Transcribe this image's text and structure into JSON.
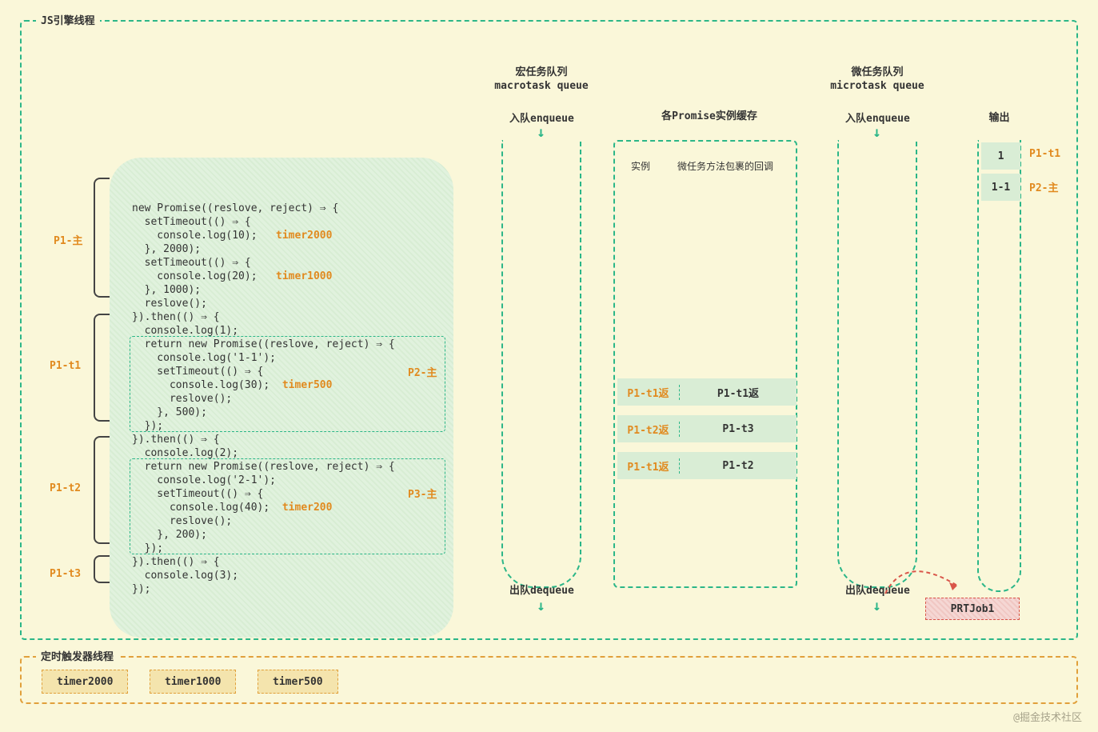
{
  "jsEngine": {
    "label": "JS引擎线程"
  },
  "timerThread": {
    "label": "定时触发器线程"
  },
  "code": {
    "timers": {
      "t2000": "timer2000",
      "t1000": "timer1000",
      "t500": "timer500",
      "t200": "timer200"
    },
    "lines": {
      "l1": "new Promise((reslove, reject) ⇒ {",
      "l2": "  setTimeout(() ⇒ {",
      "l3": "    console.log(10);   ",
      "l4": "  }, 2000);",
      "l5": "  setTimeout(() ⇒ {",
      "l6": "    console.log(20);   ",
      "l7": "  }, 1000);",
      "l8": "  reslove();",
      "l9": "}).then(() ⇒ {",
      "l10": "  console.log(1);",
      "l11": "  return new Promise((reslove, reject) ⇒ {",
      "l12": "    console.log('1-1');",
      "l13": "    setTimeout(() ⇒ {",
      "l14": "      console.log(30);  ",
      "l15": "      reslove();",
      "l16": "    }, 500);",
      "l17": "  });",
      "l18": "}).then(() ⇒ {",
      "l19": "  console.log(2);",
      "l20": "  return new Promise((reslove, reject) ⇒ {",
      "l21": "    console.log('2-1');",
      "l22": "    setTimeout(() ⇒ {",
      "l23": "      console.log(40);  ",
      "l24": "      reslove();",
      "l25": "    }, 200);",
      "l26": "  });",
      "l27": "}).then(() ⇒ {",
      "l28": "  console.log(3);",
      "l29": "});"
    }
  },
  "brackets": {
    "p1main": "P1-主",
    "p1t1": "P1-t1",
    "p1t2": "P1-t2",
    "p1t3": "P1-t3",
    "p2main": "P2-主",
    "p3main": "P3-主"
  },
  "macro": {
    "title1": "宏任务队列",
    "title2": "macrotask queue",
    "enq": "入队enqueue",
    "deq": "出队dequeue"
  },
  "micro": {
    "title1": "微任务队列",
    "title2": "microtask queue",
    "enq": "入队enqueue",
    "deq": "出队dequeue"
  },
  "cache": {
    "title": "各Promise实例缓存",
    "hdr_inst": "实例",
    "hdr_cb": "微任务方法包裹的回调",
    "rows": [
      {
        "inst": "P1-t1返",
        "cb": "P1-t1返"
      },
      {
        "inst": "P1-t2返",
        "cb": "P1-t3"
      },
      {
        "inst": "P1-t1返",
        "cb": "P1-t2"
      }
    ]
  },
  "output": {
    "title": "输出",
    "items": [
      {
        "val": "1",
        "src": "P1-t1"
      },
      {
        "val": "1-1",
        "src": "P2-主"
      }
    ]
  },
  "prtjob": "PRTJob1",
  "timerPills": [
    "timer2000",
    "timer1000",
    "timer500"
  ],
  "watermark": "@掘金技术社区"
}
